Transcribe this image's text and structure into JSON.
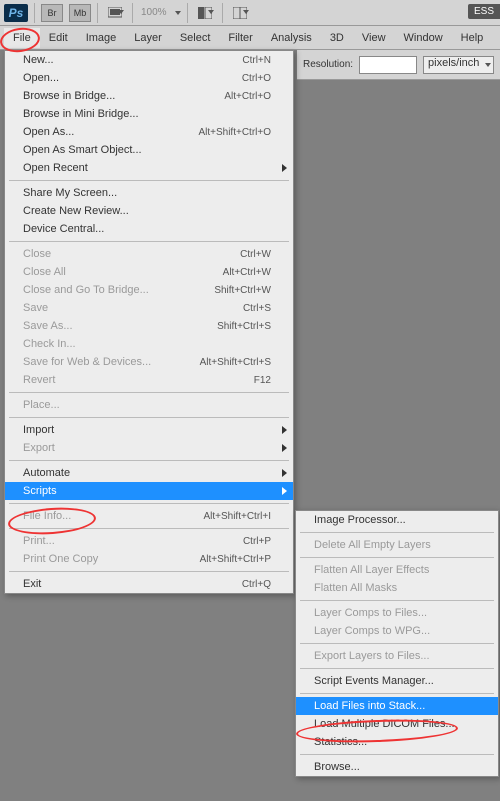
{
  "toolbar": {
    "ps": "Ps",
    "br": "Br",
    "mb": "Mb",
    "zoom": "100%",
    "ess": "ESS"
  },
  "menubar": [
    "File",
    "Edit",
    "Image",
    "Layer",
    "Select",
    "Filter",
    "Analysis",
    "3D",
    "View",
    "Window",
    "Help"
  ],
  "options": {
    "res_label": "Resolution:",
    "res_value": "",
    "unit": "pixels/inch"
  },
  "file_menu": [
    {
      "label": "New...",
      "shortcut": "Ctrl+N"
    },
    {
      "label": "Open...",
      "shortcut": "Ctrl+O"
    },
    {
      "label": "Browse in Bridge...",
      "shortcut": "Alt+Ctrl+O"
    },
    {
      "label": "Browse in Mini Bridge..."
    },
    {
      "label": "Open As...",
      "shortcut": "Alt+Shift+Ctrl+O"
    },
    {
      "label": "Open As Smart Object..."
    },
    {
      "label": "Open Recent",
      "submenu": true
    },
    {
      "sep": true
    },
    {
      "label": "Share My Screen..."
    },
    {
      "label": "Create New Review..."
    },
    {
      "label": "Device Central..."
    },
    {
      "sep": true
    },
    {
      "label": "Close",
      "shortcut": "Ctrl+W",
      "disabled": true
    },
    {
      "label": "Close All",
      "shortcut": "Alt+Ctrl+W",
      "disabled": true
    },
    {
      "label": "Close and Go To Bridge...",
      "shortcut": "Shift+Ctrl+W",
      "disabled": true
    },
    {
      "label": "Save",
      "shortcut": "Ctrl+S",
      "disabled": true
    },
    {
      "label": "Save As...",
      "shortcut": "Shift+Ctrl+S",
      "disabled": true
    },
    {
      "label": "Check In...",
      "disabled": true
    },
    {
      "label": "Save for Web & Devices...",
      "shortcut": "Alt+Shift+Ctrl+S",
      "disabled": true
    },
    {
      "label": "Revert",
      "shortcut": "F12",
      "disabled": true
    },
    {
      "sep": true
    },
    {
      "label": "Place...",
      "disabled": true
    },
    {
      "sep": true
    },
    {
      "label": "Import",
      "submenu": true
    },
    {
      "label": "Export",
      "submenu": true,
      "disabled": true
    },
    {
      "sep": true
    },
    {
      "label": "Automate",
      "submenu": true
    },
    {
      "label": "Scripts",
      "submenu": true,
      "highlight": true
    },
    {
      "sep": true
    },
    {
      "label": "File Info...",
      "shortcut": "Alt+Shift+Ctrl+I",
      "disabled": true
    },
    {
      "sep": true
    },
    {
      "label": "Print...",
      "shortcut": "Ctrl+P",
      "disabled": true
    },
    {
      "label": "Print One Copy",
      "shortcut": "Alt+Shift+Ctrl+P",
      "disabled": true
    },
    {
      "sep": true
    },
    {
      "label": "Exit",
      "shortcut": "Ctrl+Q"
    }
  ],
  "scripts_menu": [
    {
      "label": "Image Processor..."
    },
    {
      "sep": true
    },
    {
      "label": "Delete All Empty Layers",
      "disabled": true
    },
    {
      "sep": true
    },
    {
      "label": "Flatten All Layer Effects",
      "disabled": true
    },
    {
      "label": "Flatten All Masks",
      "disabled": true
    },
    {
      "sep": true
    },
    {
      "label": "Layer Comps to Files...",
      "disabled": true
    },
    {
      "label": "Layer Comps to WPG...",
      "disabled": true
    },
    {
      "sep": true
    },
    {
      "label": "Export Layers to Files...",
      "disabled": true
    },
    {
      "sep": true
    },
    {
      "label": "Script Events Manager..."
    },
    {
      "sep": true
    },
    {
      "label": "Load Files into Stack...",
      "highlight": true
    },
    {
      "label": "Load Multiple DICOM Files..."
    },
    {
      "label": "Statistics..."
    },
    {
      "sep": true
    },
    {
      "label": "Browse..."
    }
  ]
}
